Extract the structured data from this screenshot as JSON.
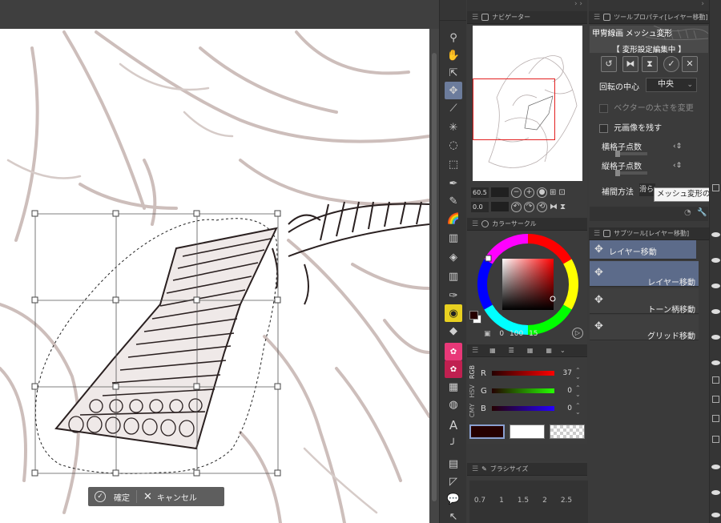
{
  "navigator": {
    "tab_label": "ナビゲーター",
    "zoom_value": "60.5",
    "rotate_value": "0.0"
  },
  "tool_property": {
    "tab_label": "ツールプロパティ[レイヤー移動]",
    "layer_name": "甲冑線画 メッシュ変形",
    "status": "【 変形設定編集中 】",
    "rotation_center_label": "回転の中心",
    "rotation_center_value": "中央",
    "vector_width_label": "ベクターの太さを変更",
    "keep_original_label": "元画像を残す",
    "horizontal_points_label": "横格子点数",
    "vertical_points_label": "縦格子点数",
    "interpolation_label": "補間方法",
    "interpolation_value": "滑らか(バイ",
    "tooltip": "メッシュ変形の縦方"
  },
  "color_circle": {
    "tab_label": "カラーサークル",
    "values": [
      "0",
      "100",
      "15"
    ]
  },
  "color_slider": {
    "mode_labels": [
      "RGB",
      "HSV",
      "CMY"
    ],
    "r": {
      "label": "R",
      "value": "37"
    },
    "g": {
      "label": "G",
      "value": "0"
    },
    "b": {
      "label": "B",
      "value": "0"
    }
  },
  "subtool": {
    "tab_label": "サブツール[レイヤー移動]",
    "group_label": "レイヤー移動",
    "items": [
      {
        "label": "レイヤー移動"
      },
      {
        "label": "トーン柄移動"
      },
      {
        "label": "グリッド移動"
      }
    ]
  },
  "brush_size": {
    "tab_label": "ブラシサイズ",
    "sizes": [
      "0.7",
      "1",
      "1.5",
      "2",
      "2.5"
    ]
  },
  "canvas": {
    "confirm_label": "確定",
    "cancel_label": "キャンセル"
  },
  "colors": {
    "accent": "#5c6b8a",
    "nav_rect": "#e32020",
    "main_color": "#250000",
    "sub_color": "#ffffff"
  }
}
